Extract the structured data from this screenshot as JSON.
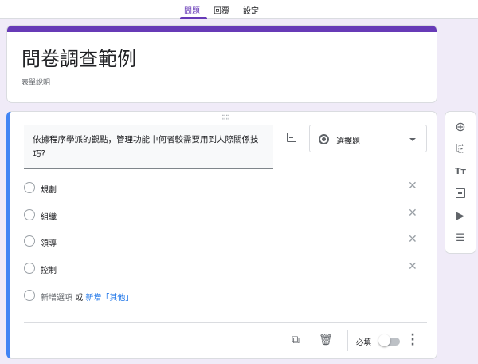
{
  "tabs": [
    {
      "label": "問題",
      "active": true
    },
    {
      "label": "回覆"
    },
    {
      "label": "設定"
    }
  ],
  "form": {
    "title": "問卷調查範例",
    "description_placeholder": "表單說明"
  },
  "question": {
    "text": "依據程序學派的觀點，管理功能中何者較需要用到人際關係技巧?",
    "type": "選擇題",
    "options": [
      "規劃",
      "組織",
      "領導",
      "控制"
    ],
    "add_option": "新增選項",
    "or": "或",
    "add_other": "新增「其他」",
    "required_label": "必填",
    "required": false
  },
  "colors": {
    "accent": "#673ab7",
    "active_border": "#4285f4",
    "link": "#1a73e8",
    "background": "#f0ebf8"
  }
}
